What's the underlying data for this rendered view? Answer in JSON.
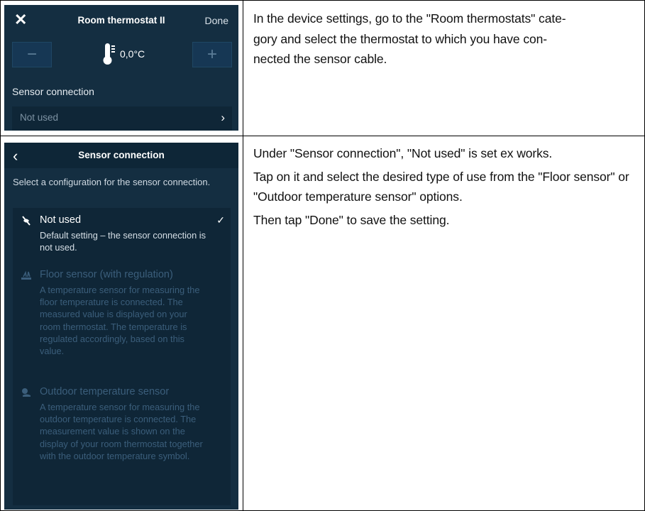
{
  "table": {
    "row1_text": "In the device settings, go to the \"Room thermostats\" cate-gory and select the thermostat to which you have con-nected the sensor cable.",
    "row1_lines": [
      "In the device settings, go to the \"Room thermostats\" cate-",
      "gory and select the thermostat to which you have con-",
      "nected the sensor cable."
    ],
    "row2_paragraphs": [
      "Under \"Sensor connection\", \"Not used\" is set ex works.",
      "Tap on it and select the desired type of use from the \"Floor sensor\" or \"Outdoor temperature sensor\" options.",
      "Then tap \"Done\" to save the setting."
    ]
  },
  "screen1": {
    "title": "Room thermostat II",
    "close_glyph": "✕",
    "done_label": "Done",
    "minus_glyph": "−",
    "plus_glyph": "+",
    "temperature": "0,0°C",
    "sensor_connection_label": "Sensor connection",
    "sensor_connection_value": "Not used",
    "chevron_glyph": "›"
  },
  "screen2": {
    "back_glyph": "‹",
    "title": "Sensor connection",
    "description": "Select a configuration for the sensor connection.",
    "options": [
      {
        "title": "Not used",
        "description": "Default setting – the sensor connection is not used.",
        "selected": true
      },
      {
        "title": "Floor sensor (with regulation)",
        "description": "A temperature sensor for measuring the floor temperature is connected. The measured value is displayed on your room thermostat. The temperature is regulated accordingly, based on this value.",
        "selected": false
      },
      {
        "title": "Outdoor temperature sensor",
        "description": "A temperature sensor for measuring the outdoor temperature is connected. The measurement value is shown on the display of your room thermostat together with the outdoor temperature symbol.",
        "selected": false
      }
    ],
    "check_glyph": "✓"
  },
  "colors": {
    "screen_bg": "#142e41",
    "panel_bg": "#0f2637",
    "dim_text": "#3b5e7b",
    "text_dark": "#111111"
  },
  "icons": [
    "close-icon",
    "minus-icon",
    "plus-icon",
    "thermometer-icon",
    "chevron-right-icon",
    "back-chevron-icon",
    "sensor-off-icon",
    "floor-sensor-icon",
    "outdoor-sensor-icon",
    "checkmark-icon"
  ]
}
